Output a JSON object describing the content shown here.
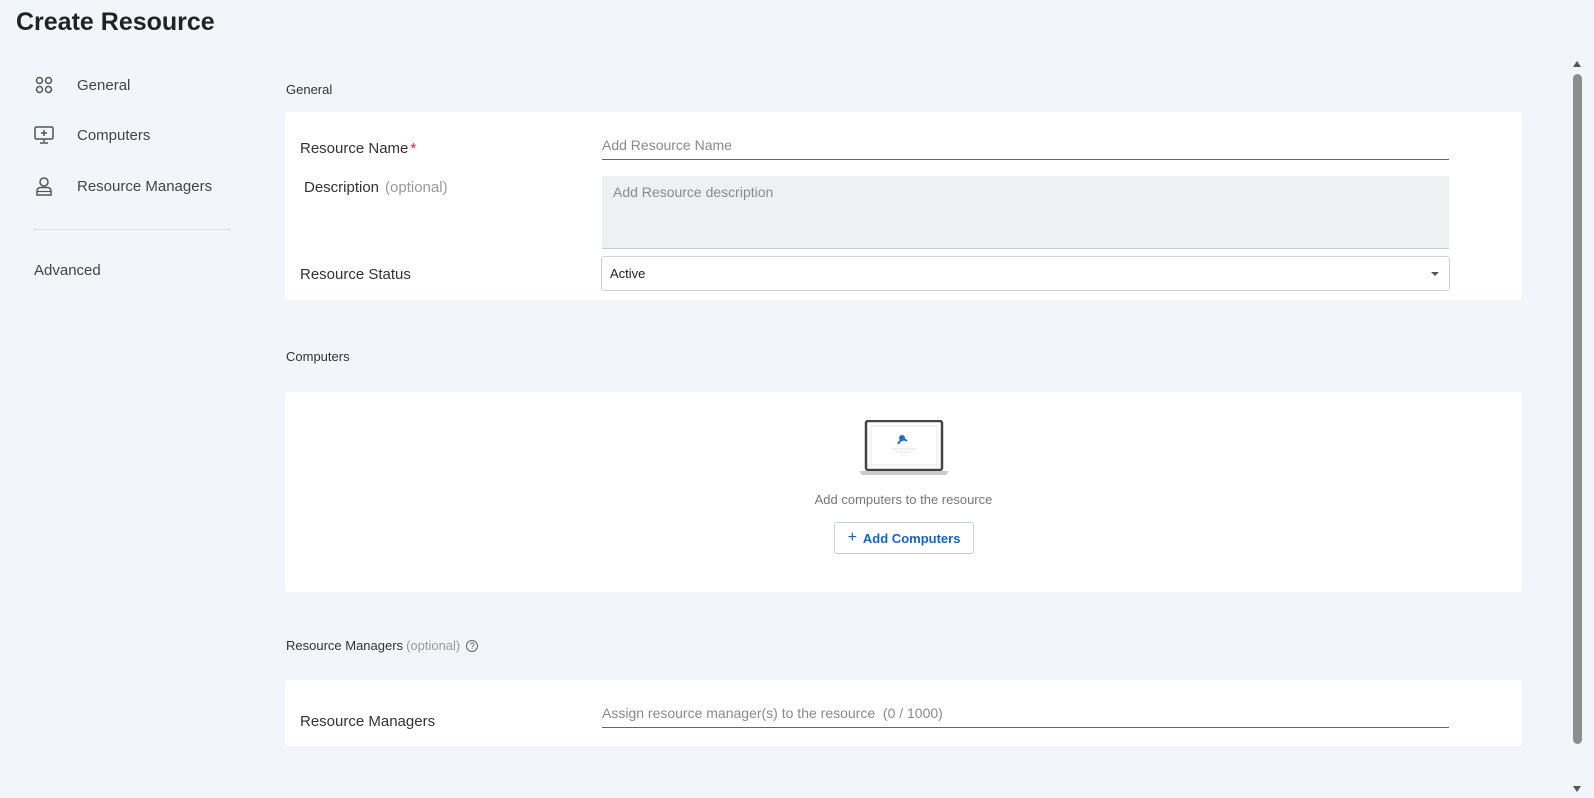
{
  "page": {
    "title": "Create Resource"
  },
  "sidebar": {
    "items": [
      {
        "label": "General",
        "icon": "grid-icon"
      },
      {
        "label": "Computers",
        "icon": "monitor-add-icon"
      },
      {
        "label": "Resource Managers",
        "icon": "user-icon"
      }
    ],
    "advanced_label": "Advanced"
  },
  "general": {
    "section_title": "General",
    "resource_name": {
      "label": "Resource Name",
      "required_mark": "*",
      "placeholder": "Add Resource Name",
      "value": ""
    },
    "description": {
      "label": "Description",
      "optional": "(optional)",
      "placeholder": "Add Resource description",
      "value": ""
    },
    "status": {
      "label": "Resource Status",
      "value": "Active"
    }
  },
  "computers": {
    "section_title": "Computers",
    "empty_text": "Add computers to the resource",
    "add_button_label": "Add Computers"
  },
  "managers": {
    "section_title": "Resource Managers",
    "section_optional": "(optional)",
    "field_label": "Resource Managers",
    "placeholder": "Assign resource manager(s) to the resource  (0 / 1000)"
  },
  "colors": {
    "background": "#f2f5f9",
    "accent": "#1565c0",
    "required": "#d9243a"
  }
}
